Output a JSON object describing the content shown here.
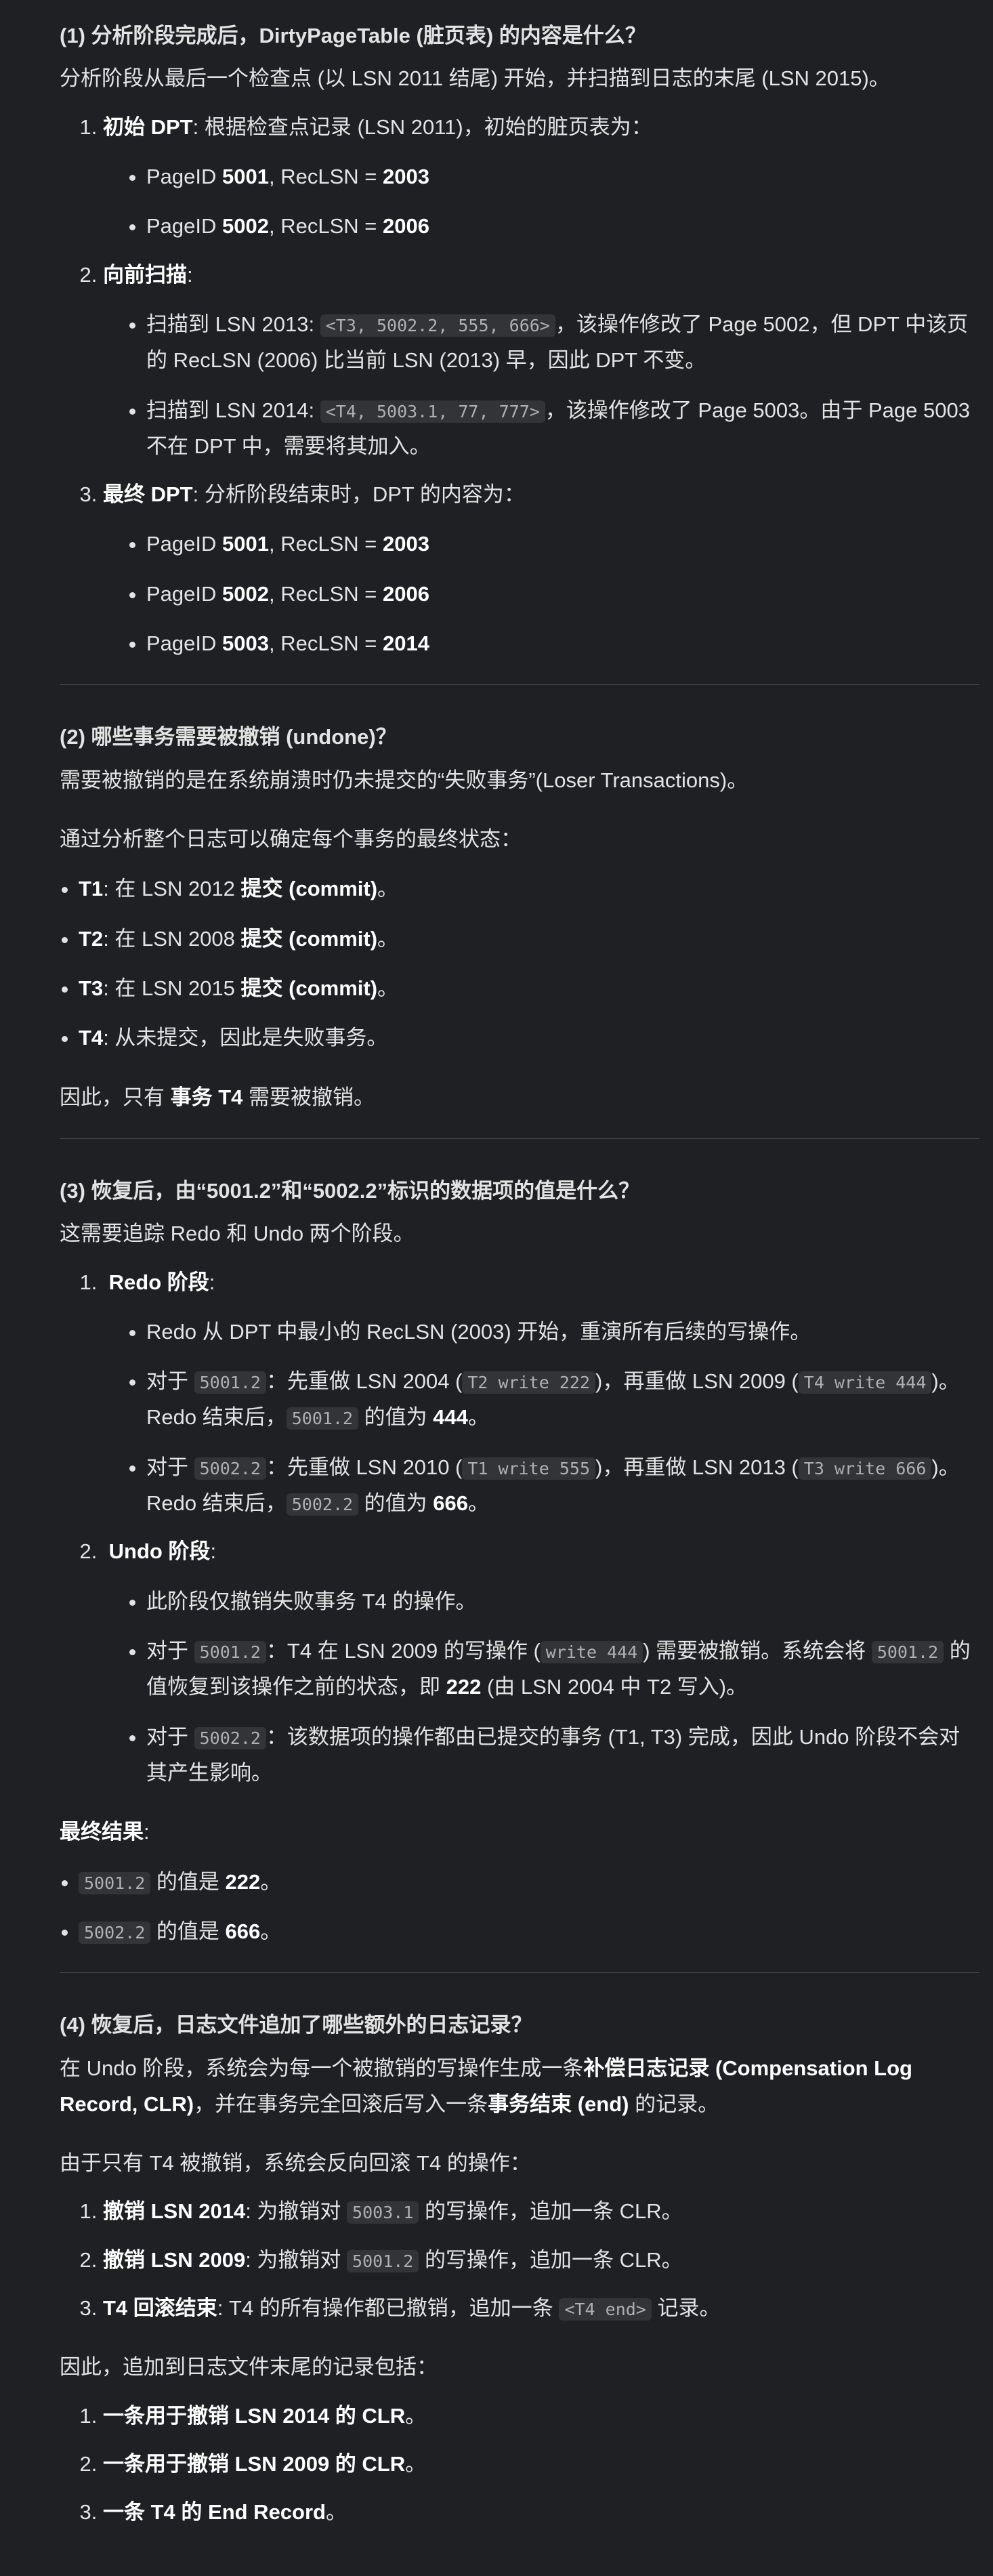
{
  "s1": {
    "title": "(1) 分析阶段完成后，DirtyPageTable (脏页表) 的内容是什么？",
    "intro": "分析阶段从最后一个检查点 (以 LSN 2011 结尾) 开始，并扫描到日志的末尾 (LSN 2015)。",
    "i1": {
      "head": "初始 DPT",
      "rest": ": 根据检查点记录 (LSN 2011)，初始的脏页表为："
    },
    "i1a": {
      "p1": "PageID ",
      "b1": "5001",
      "p2": ", RecLSN = ",
      "b2": "2003"
    },
    "i1b": {
      "p1": "PageID ",
      "b1": "5002",
      "p2": ", RecLSN = ",
      "b2": "2006"
    },
    "i2": {
      "head": "向前扫描",
      "rest": ":"
    },
    "i2a": {
      "pre": "扫描到 LSN 2013: ",
      "code": "<T3, 5002.2, 555, 666>",
      "post": "，该操作修改了 Page 5002，但 DPT 中该页的 RecLSN (2006) 比当前 LSN (2013) 早，因此 DPT 不变。"
    },
    "i2b": {
      "pre": "扫描到 LSN 2014: ",
      "code": "<T4, 5003.1, 77, 777>",
      "post": "，该操作修改了 Page 5003。由于 Page 5003 不在 DPT 中，需要将其加入。"
    },
    "i3": {
      "head": "最终 DPT",
      "rest": ": 分析阶段结束时，DPT 的内容为："
    },
    "i3a": {
      "p1": "PageID ",
      "b1": "5001",
      "p2": ", RecLSN = ",
      "b2": "2003"
    },
    "i3b": {
      "p1": "PageID ",
      "b1": "5002",
      "p2": ", RecLSN = ",
      "b2": "2006"
    },
    "i3c": {
      "p1": "PageID ",
      "b1": "5003",
      "p2": ", RecLSN = ",
      "b2": "2014"
    }
  },
  "s2": {
    "title": "(2) 哪些事务需要被撤销 (undone)？",
    "intro": "需要被撤销的是在系统崩溃时仍未提交的“失败事务”(Loser Transactions)。",
    "intro2": "通过分析整个日志可以确定每个事务的最终状态：",
    "t1": {
      "b": "T1",
      "p": ": 在 LSN 2012 ",
      "b2": "提交 (commit)",
      "e": "。"
    },
    "t2": {
      "b": "T2",
      "p": ": 在 LSN 2008 ",
      "b2": "提交 (commit)",
      "e": "。"
    },
    "t3": {
      "b": "T3",
      "p": ": 在 LSN 2015 ",
      "b2": "提交 (commit)",
      "e": "。"
    },
    "t4": {
      "b": "T4",
      "p": ": 从未提交，因此是失败事务。"
    },
    "concl": {
      "p1": "因此，只有 ",
      "b": "事务 T4",
      "p2": " 需要被撤销。"
    }
  },
  "s3": {
    "title": "(3) 恢复后，由“5001.2”和“5002.2”标识的数据项的值是什么？",
    "intro": "这需要追踪 Redo 和 Undo 两个阶段。",
    "redo_head": "Redo 阶段",
    "redo_colon": ":",
    "r1": "Redo 从 DPT 中最小的 RecLSN (2003) 开始，重演所有后续的写操作。",
    "r2": {
      "p1": "对于 ",
      "c1": "5001.2",
      "p2": "：先重做 LSN 2004 (",
      "c2": "T2 write 222",
      "p3": ")，再重做 LSN 2009 (",
      "c3": "T4 write 444",
      "p4": ")。Redo 结束后，",
      "c4": "5001.2",
      "p5": " 的值为 ",
      "b": "444",
      "p6": "。"
    },
    "r3": {
      "p1": "对于 ",
      "c1": "5002.2",
      "p2": "：先重做 LSN 2010 (",
      "c2": "T1 write 555",
      "p3": ")，再重做 LSN 2013 (",
      "c3": "T3 write 666",
      "p4": ")。Redo 结束后，",
      "c4": "5002.2",
      "p5": " 的值为 ",
      "b": "666",
      "p6": "。"
    },
    "undo_head": "Undo 阶段",
    "undo_colon": ":",
    "u1": "此阶段仅撤销失败事务 T4 的操作。",
    "u2": {
      "p1": "对于 ",
      "c1": "5001.2",
      "p2": "：T4 在 LSN 2009 的写操作 (",
      "c2": "write 444",
      "p3": ") 需要被撤销。系统会将 ",
      "c3": "5001.2",
      "p4": " 的值恢复到该操作之前的状态，即 ",
      "b": "222",
      "p5": " (由 LSN 2004 中 T2 写入)。"
    },
    "u3": {
      "p1": "对于 ",
      "c1": "5002.2",
      "p2": "：该数据项的操作都由已提交的事务 (T1, T3) 完成，因此 Undo 阶段不会对其产生影响。"
    },
    "final_head": "最终结果",
    "final_colon": ":",
    "f1": {
      "c": "5001.2",
      "p": " 的值是 ",
      "b": "222",
      "e": "。"
    },
    "f2": {
      "c": "5002.2",
      "p": " 的值是 ",
      "b": "666",
      "e": "。"
    }
  },
  "s4": {
    "title": "(4) 恢复后，日志文件追加了哪些额外的日志记录？",
    "intro": {
      "p1": "在 Undo 阶段，系统会为每一个被撤销的写操作生成一条",
      "b1": "补偿日志记录 (Compensation Log Record, CLR)",
      "p2": "，并在事务完全回滚后写入一条",
      "b2": "事务结束 (end)",
      "p3": " 的记录。"
    },
    "intro2": "由于只有 T4 被撤销，系统会反向回滚 T4 的操作：",
    "k1": {
      "b": "撤销 LSN 2014",
      "p1": ": 为撤销对 ",
      "c": "5003.1",
      "p2": " 的写操作，追加一条 CLR。"
    },
    "k2": {
      "b": "撤销 LSN 2009",
      "p1": ": 为撤销对 ",
      "c": "5001.2",
      "p2": " 的写操作，追加一条 CLR。"
    },
    "k3": {
      "b": "T4 回滚结束",
      "p1": ": T4 的所有操作都已撤销，追加一条 ",
      "c": "<T4 end>",
      "p2": " 记录。"
    },
    "concl": "因此，追加到日志文件末尾的记录包括：",
    "e1": {
      "b": "一条用于撤销 LSN 2014 的 CLR",
      "e": "。"
    },
    "e2": {
      "b": "一条用于撤销 LSN 2009 的 CLR",
      "e": "。"
    },
    "e3": {
      "b": "一条 T4 的 End Record",
      "e": "。"
    }
  }
}
